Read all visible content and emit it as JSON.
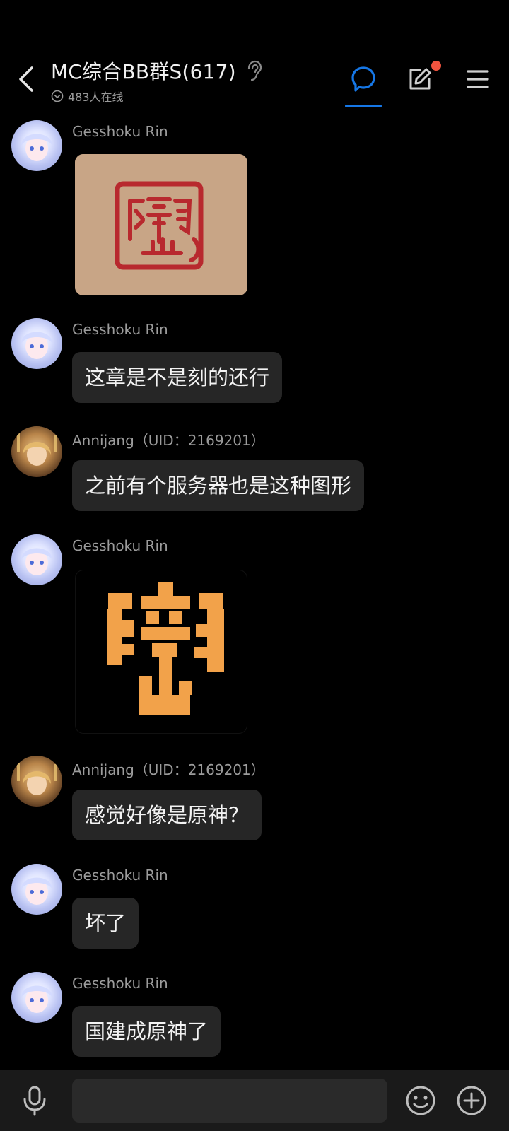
{
  "header": {
    "title": "MC综合BB群S(617)",
    "online": "483人在线",
    "icons": [
      "back-icon",
      "ear-icon",
      "chat-bubble-icon",
      "edit-icon",
      "menu-icon"
    ],
    "accent_color": "#1677e6",
    "badge_color": "#f2543f"
  },
  "messages": [
    {
      "sender": "Gesshoku Rin",
      "type": "image",
      "image": "red-seal-stamp"
    },
    {
      "sender": "Gesshoku Rin",
      "type": "text",
      "text": "这章是不是刻的还行"
    },
    {
      "sender": "Annijang（UID：2169201）",
      "type": "text",
      "text": "之前有个服务器也是这种图形"
    },
    {
      "sender": "Gesshoku Rin",
      "type": "image",
      "image": "orange-pixel-seal"
    },
    {
      "sender": "Annijang（UID：2169201）",
      "type": "text",
      "text": "感觉好像是原神？"
    },
    {
      "sender": "Gesshoku Rin",
      "type": "text",
      "text": "坏了"
    },
    {
      "sender": "Gesshoku Rin",
      "type": "text",
      "text": "国建成原神了"
    }
  ],
  "bottom": {
    "input_value": "",
    "icons": [
      "microphone-icon",
      "emoji-icon",
      "plus-icon"
    ]
  }
}
